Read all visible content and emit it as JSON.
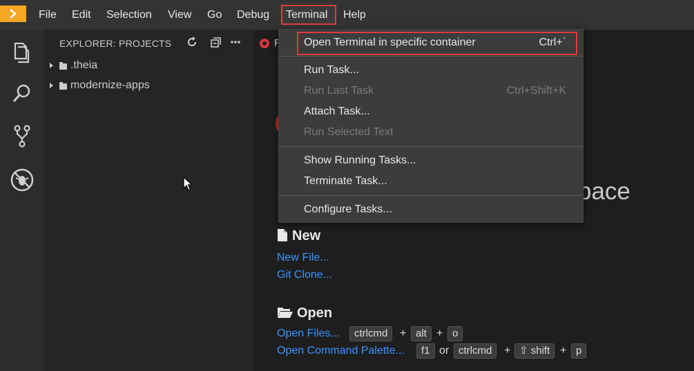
{
  "menubar": {
    "items": [
      "File",
      "Edit",
      "Selection",
      "View",
      "Go",
      "Debug",
      "Terminal",
      "Help"
    ],
    "highlight_color": "#e03c3c",
    "logo_color": "#f5a623"
  },
  "activitybar": {
    "icons": [
      "files-icon",
      "search-icon",
      "source-control-icon",
      "debug-icon"
    ]
  },
  "sidebar": {
    "title": "EXPLORER: PROJECTS",
    "tree": [
      ".theia",
      "modernize-apps"
    ]
  },
  "editor": {
    "tab_label": "P",
    "workspace_heading_fragment": "pace",
    "new_section": {
      "title": "New",
      "links": [
        "New File...",
        "Git Clone..."
      ]
    },
    "open_section": {
      "title": "Open",
      "open_files_link": "Open Files...",
      "open_files_keys": [
        "ctrlcmd",
        "alt",
        "o"
      ],
      "command_palette_link": "Open Command Palette...",
      "command_palette_keys_a": [
        "f1"
      ],
      "or_text": "or",
      "command_palette_keys_b": [
        "ctrlcmd",
        "⇧ shift",
        "p"
      ],
      "plus": "+"
    },
    "link_color": "#3794ff"
  },
  "terminal_menu": {
    "items": [
      {
        "label": "Open Terminal in specific container",
        "shortcut": "Ctrl+`",
        "disabled": false
      },
      {
        "label": "Run Task...",
        "shortcut": "",
        "disabled": false
      },
      {
        "label": "Run Last Task",
        "shortcut": "Ctrl+Shift+K",
        "disabled": true
      },
      {
        "label": "Attach Task...",
        "shortcut": "",
        "disabled": false
      },
      {
        "label": "Run Selected Text",
        "shortcut": "",
        "disabled": true
      },
      {
        "label": "Show Running Tasks...",
        "shortcut": "",
        "disabled": false
      },
      {
        "label": "Terminate Task...",
        "shortcut": "",
        "disabled": false
      },
      {
        "label": "Configure Tasks...",
        "shortcut": "",
        "disabled": false
      }
    ]
  }
}
